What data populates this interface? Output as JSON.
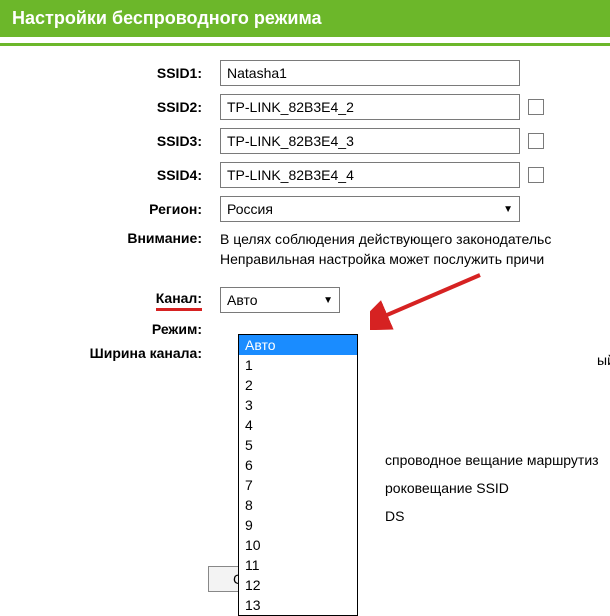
{
  "header": {
    "title": "Настройки беспроводного режима"
  },
  "labels": {
    "ssid1": "SSID1:",
    "ssid2": "SSID2:",
    "ssid3": "SSID3:",
    "ssid4": "SSID4:",
    "region": "Регион:",
    "warning": "Внимание:",
    "channel": "Канал:",
    "mode": "Режим:",
    "width": "Ширина канала:"
  },
  "values": {
    "ssid1": "Natasha1",
    "ssid2": "TP-LINK_82B3E4_2",
    "ssid3": "TP-LINK_82B3E4_3",
    "ssid4": "TP-LINK_82B3E4_4",
    "region": "Россия",
    "warning_line1": "В целях соблюдения действующего законодательс",
    "warning_line2": "Неправильная настройка может послужить причи",
    "channel": "Авто",
    "mode_partial": "ый",
    "side1": "спроводное вещание маршрутиз",
    "side2": "роковещание SSID",
    "side3": "DS"
  },
  "channel_options": [
    "Авто",
    "1",
    "2",
    "3",
    "4",
    "5",
    "6",
    "7",
    "8",
    "9",
    "10",
    "11",
    "12",
    "13"
  ],
  "button": {
    "label_partial": "С"
  }
}
